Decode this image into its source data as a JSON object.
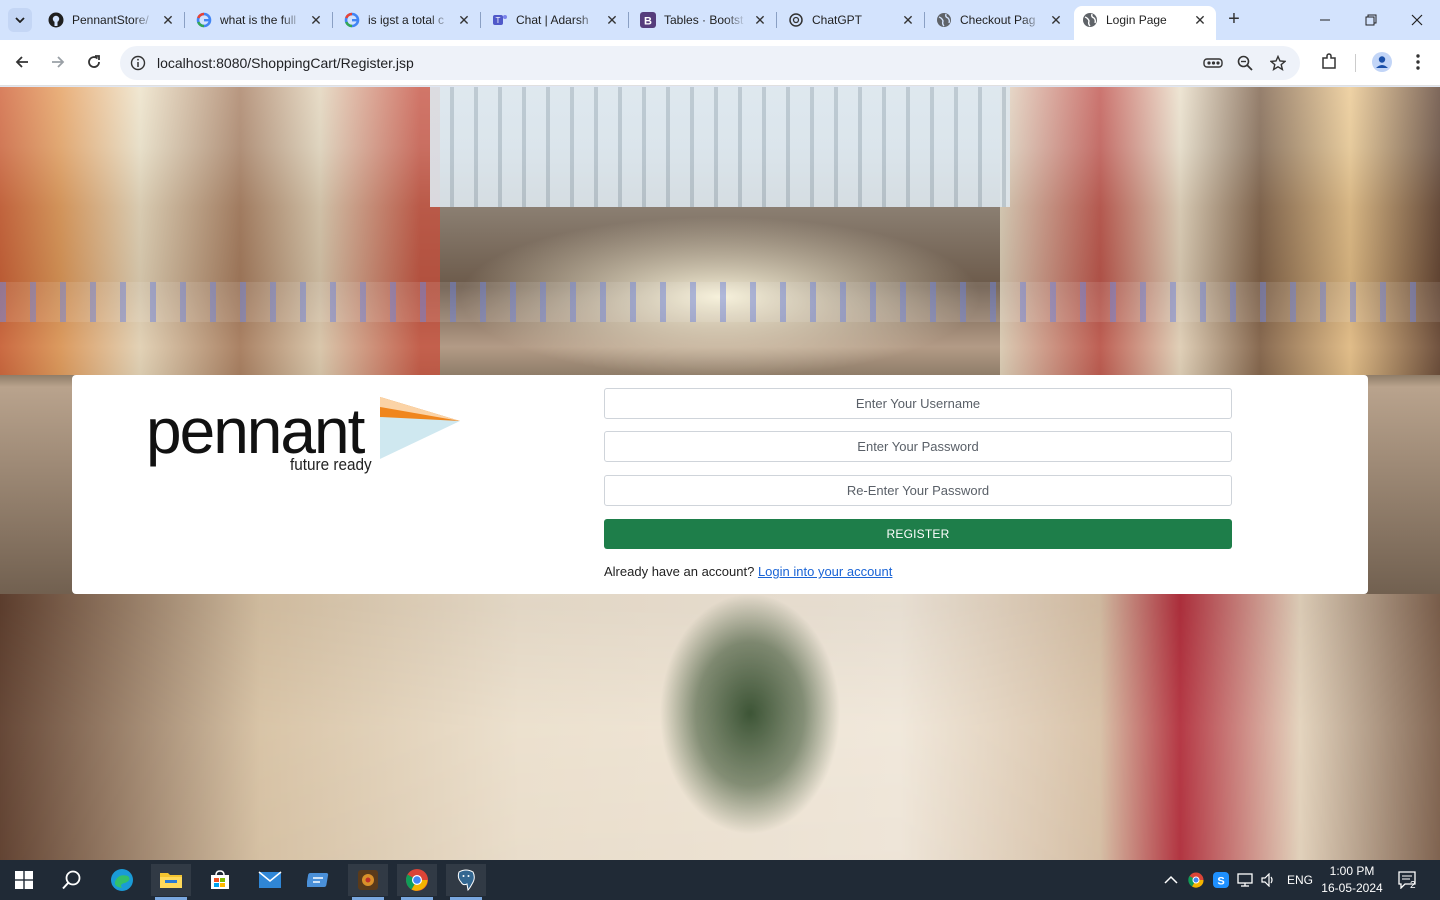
{
  "browser": {
    "tabs": [
      {
        "label": "PennantStore/",
        "icon": "github-icon"
      },
      {
        "label": "what is the full",
        "icon": "google-icon"
      },
      {
        "label": "is igst a total c",
        "icon": "google-icon"
      },
      {
        "label": "Chat | Adarsh",
        "icon": "teams-icon"
      },
      {
        "label": "Tables · Bootst",
        "icon": "bootstrap-icon"
      },
      {
        "label": "ChatGPT",
        "icon": "chatgpt-icon"
      },
      {
        "label": "Checkout Pag",
        "icon": "globe-icon"
      },
      {
        "label": "Login Page",
        "icon": "globe-icon",
        "active": true
      }
    ],
    "url": "localhost:8080/ShoppingCart/Register.jsp"
  },
  "page": {
    "logo": {
      "word": "pennant",
      "tagline": "future ready"
    },
    "form": {
      "username_placeholder": "Enter Your Username",
      "password_placeholder": "Enter Your Password",
      "repassword_placeholder": "Re-Enter Your Password",
      "register_label": "REGISTER"
    },
    "login_prompt": "Already have an account?",
    "login_link": "Login into your account"
  },
  "taskbar": {
    "lang": "ENG",
    "time": "1:00 PM",
    "date": "16-05-2024",
    "notifications": "2"
  },
  "colors": {
    "accent_green": "#1e7e4a",
    "link_blue": "#1a64d6",
    "tabstrip": "#d3e3fd"
  }
}
